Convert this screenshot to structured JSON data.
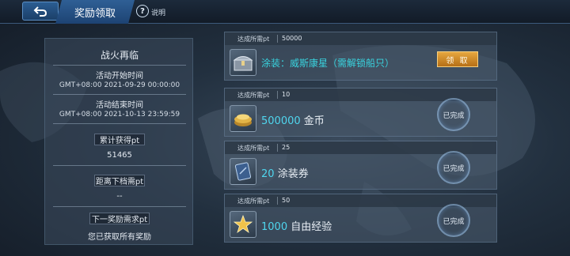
{
  "header": {
    "title": "奖励领取",
    "help_label": "说明"
  },
  "summary": {
    "event_name": "战火再临",
    "start_label": "活动开始时间",
    "start_value": "GMT+08:00 2021-09-29 00:00:00",
    "end_label": "活动结束时间",
    "end_value": "GMT+08:00 2021-10-13 23:59:59",
    "earned_label": "累计获得pt",
    "earned_value": "51465",
    "next_tier_label": "距离下档需pt",
    "next_tier_value": "--",
    "next_reward_label": "下一奖励需求pt",
    "all_claimed_text": "您已获取所有奖励"
  },
  "rewards": [
    {
      "req_label": "达成所需pt",
      "req_value": "50000",
      "amount": "",
      "name": "涂装：威斯康星（需解锁船只）",
      "action": "领 取",
      "icon": "chest-icon"
    },
    {
      "req_label": "达成所需pt",
      "req_value": "10",
      "amount": "500000",
      "name": "金币",
      "action": "已完成",
      "icon": "gold-coins-icon"
    },
    {
      "req_label": "达成所需pt",
      "req_value": "25",
      "amount": "20",
      "name": "涂装券",
      "action": "已完成",
      "icon": "camo-ticket-icon"
    },
    {
      "req_label": "达成所需pt",
      "req_value": "50",
      "amount": "1000",
      "name": "自由经验",
      "action": "已完成",
      "icon": "star-xp-icon"
    }
  ],
  "colors": {
    "accent_cyan": "#39d3df",
    "claim_orange": "#d98e2b",
    "header_blue": "#2f5f95"
  }
}
